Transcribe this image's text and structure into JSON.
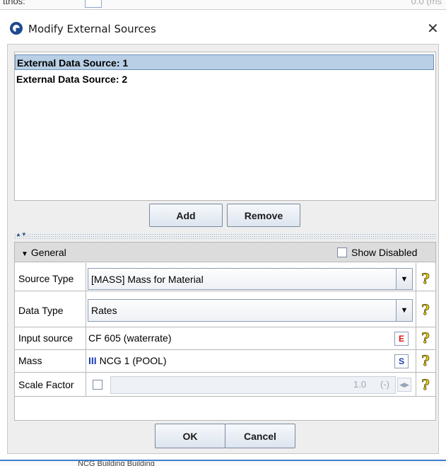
{
  "background": {
    "top_left_text": "ttnos:",
    "top_right_text": "0.0 (ms",
    "bottom_text": "NCG Building Building"
  },
  "window": {
    "title": "Modify External Sources",
    "close_glyph": "✕",
    "icon": "app-logo-icon"
  },
  "sources": {
    "items": [
      {
        "label": "External Data Source: 1",
        "selected": true
      },
      {
        "label": "External Data Source: 2",
        "selected": false
      }
    ],
    "add_label": "Add",
    "remove_label": "Remove"
  },
  "properties": {
    "section_title": "General",
    "section_glyph": "▼",
    "show_disabled_label": "Show Disabled",
    "show_disabled_checked": false,
    "rows": {
      "source_type": {
        "label": "Source Type",
        "value": "[MASS] Mass for Material"
      },
      "data_type": {
        "label": "Data Type",
        "value": "Rates"
      },
      "input_source": {
        "label": "Input source",
        "value": "CF 605 (waterrate)",
        "button": "E"
      },
      "mass": {
        "label": "Mass",
        "value": "NCG 1 (POOL)",
        "prefix": "III",
        "button": "S"
      },
      "scale_factor": {
        "label": "Scale Factor",
        "value": "1.0",
        "unit": "(-)",
        "checked": false
      }
    },
    "help_glyph": "?",
    "dropdown_glyph": "▼"
  },
  "footer": {
    "ok_label": "OK",
    "cancel_label": "Cancel"
  },
  "colors": {
    "selection": "#b8cfe5",
    "accent": "#1d4a8f",
    "help": "#e2cc1c"
  }
}
